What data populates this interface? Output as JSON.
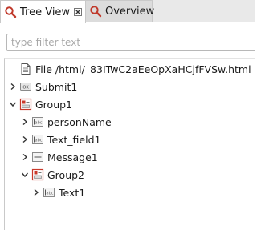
{
  "tabs": [
    {
      "label": "Tree View",
      "active": true,
      "closable": true
    },
    {
      "label": "Overview",
      "active": false,
      "closable": false
    }
  ],
  "filter": {
    "placeholder": "type filter text",
    "value": ""
  },
  "tree": {
    "nodes": [
      {
        "label": "File /html/_83ITwC2aEeOpXaHCjfFVSw.html",
        "icon": "file-icon",
        "twisty": "none",
        "depth": 0
      },
      {
        "label": "Submit1",
        "icon": "button-widget-icon",
        "twisty": "collapsed",
        "depth": 0
      },
      {
        "label": "Group1",
        "icon": "group-icon",
        "twisty": "expanded",
        "depth": 0
      },
      {
        "label": "personName",
        "icon": "text-field-icon",
        "twisty": "collapsed",
        "depth": 1
      },
      {
        "label": "Text_field1",
        "icon": "text-field-icon",
        "twisty": "collapsed",
        "depth": 1
      },
      {
        "label": "Message1",
        "icon": "message-icon",
        "twisty": "collapsed",
        "depth": 1
      },
      {
        "label": "Group2",
        "icon": "group-icon",
        "twisty": "expanded",
        "depth": 1
      },
      {
        "label": "Text1",
        "icon": "text-field-icon",
        "twisty": "collapsed",
        "depth": 2
      }
    ]
  },
  "colors": {
    "tab_active_bg": "#ffffff",
    "tab_inactive_bg": "#dcdcdc",
    "group_icon_red": "#c8382a",
    "search_icon_red": "#c0392b"
  }
}
